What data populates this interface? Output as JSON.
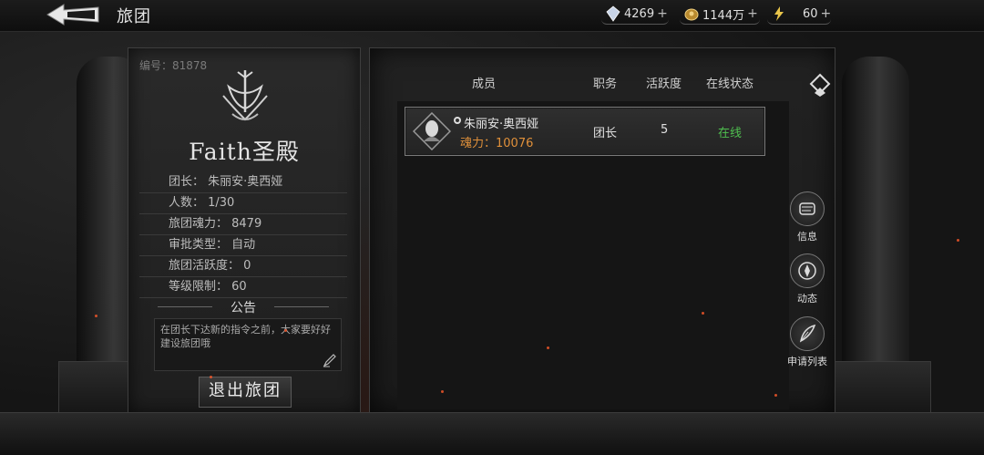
{
  "topbar": {
    "title": "旅团",
    "resources": [
      {
        "icon": "crystal-icon",
        "value": "4269"
      },
      {
        "icon": "gold-coin-icon",
        "value": "1144万"
      },
      {
        "icon": "stamina-icon",
        "value": "60"
      }
    ]
  },
  "guild": {
    "id_text": "编号：81878",
    "name": "Faith圣殿",
    "info": [
      {
        "text": "团长：  朱丽安·奥西娅"
      },
      {
        "text": "人数：  1/30"
      },
      {
        "text": "旅团魂力：  8479"
      },
      {
        "text": "审批类型：  自动"
      },
      {
        "text": "旅团活跃度：  0"
      },
      {
        "text": "等级限制：  60"
      }
    ],
    "notice_title": "公告",
    "notice_text": "在团长下达新的指令之前，大家要好好建设旅团哦",
    "quit_label": "退出旅团"
  },
  "members": {
    "headers": {
      "member": "成员",
      "role": "职务",
      "activity": "活跃度",
      "status": "在线状态"
    },
    "rows": [
      {
        "name": "朱丽安·奥西娅",
        "power": "魂力：10076",
        "role": "团长",
        "activity": "5",
        "status": "在线"
      }
    ]
  },
  "side_buttons": [
    {
      "label": "信息",
      "icon": "scroll-icon"
    },
    {
      "label": "动态",
      "icon": "compass-icon"
    },
    {
      "label": "申请列表",
      "icon": "feather-icon"
    }
  ]
}
